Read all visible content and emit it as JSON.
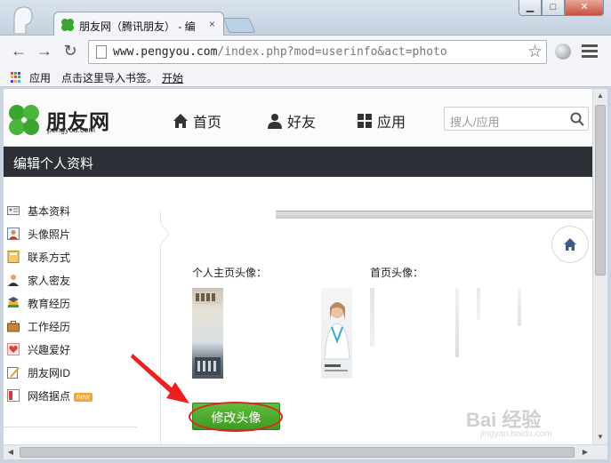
{
  "browser": {
    "tab_title": "朋友网（腾讯朋友） - 编",
    "tab_close": "×",
    "url_host": "www.pengyou.com",
    "url_path": "/index.php?mod=userinfo&act=photo",
    "window_buttons": {
      "minimize": "▁",
      "maximize": "□",
      "close": "✕"
    },
    "back": "←",
    "forward": "→",
    "reload": "↻",
    "star": "☆"
  },
  "bookmarks": {
    "apps": "应用",
    "import": "点击这里导入书签。",
    "start": "开始"
  },
  "site": {
    "logo_text": "朋友网",
    "logo_sub": "pengyou.com",
    "nav": [
      {
        "label": "首页",
        "icon": "home-icon"
      },
      {
        "label": "好友",
        "icon": "person-icon"
      },
      {
        "label": "应用",
        "icon": "grid-icon"
      }
    ],
    "search_placeholder": "搜人/应用",
    "page_title": "编辑个人资料"
  },
  "sidebar": {
    "items": [
      {
        "label": "基本资料",
        "icon": "id-card-icon"
      },
      {
        "label": "头像照片",
        "icon": "portrait-icon",
        "active": true
      },
      {
        "label": "联系方式",
        "icon": "address-book-icon"
      },
      {
        "label": "家人密友",
        "icon": "family-icon"
      },
      {
        "label": "教育经历",
        "icon": "graduation-icon"
      },
      {
        "label": "工作经历",
        "icon": "briefcase-icon"
      },
      {
        "label": "兴趣爱好",
        "icon": "heart-icon"
      },
      {
        "label": "朋友网ID",
        "icon": "id-pen-icon"
      },
      {
        "label": "网络据点",
        "icon": "bookmark-icon",
        "badge": "new"
      }
    ]
  },
  "content": {
    "profile_avatar_label": "个人主页头像：",
    "home_avatar_label": "首页头像：",
    "modify_button": "修改头像",
    "watermark": "Bai 经验",
    "watermark_sub": "jingyan.baidu.com"
  },
  "colors": {
    "accent_green": "#3f9a22",
    "header_dark": "#2c3036",
    "annotation_red": "#e52222"
  }
}
